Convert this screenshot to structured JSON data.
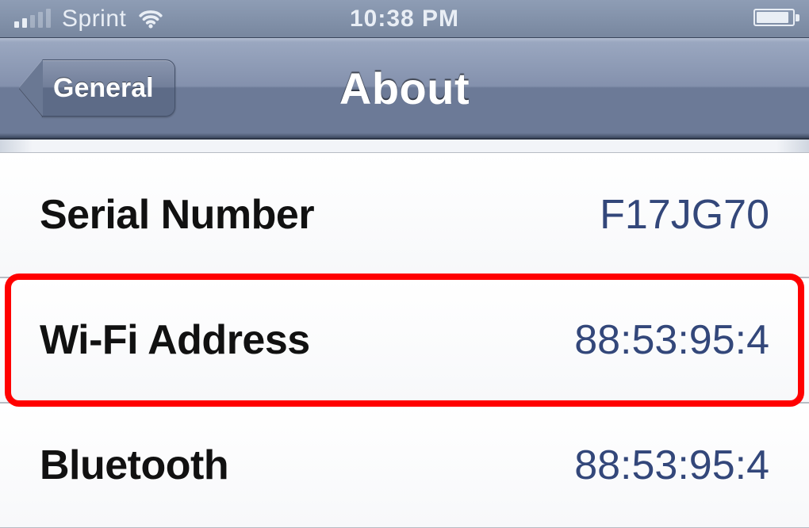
{
  "status_bar": {
    "carrier": "Sprint",
    "time": "10:38 PM",
    "signal_active_bars": 2,
    "icons": {
      "signal": "signal-bars-icon",
      "wifi": "wifi-icon",
      "battery": "battery-icon"
    }
  },
  "nav": {
    "back_label": "General",
    "title": "About"
  },
  "rows": [
    {
      "key": "serial_number",
      "label": "Serial Number",
      "value": "F17JG70",
      "highlight": false
    },
    {
      "key": "wifi_address",
      "label": "Wi-Fi Address",
      "value": "88:53:95:4",
      "highlight": true
    },
    {
      "key": "bluetooth",
      "label": "Bluetooth",
      "value": "88:53:95:4",
      "highlight": false
    }
  ],
  "colors": {
    "nav_gradient_top": "#9aa7c0",
    "nav_gradient_bottom": "#6c7a97",
    "value_text": "#33477a",
    "highlight": "#ff0000"
  }
}
